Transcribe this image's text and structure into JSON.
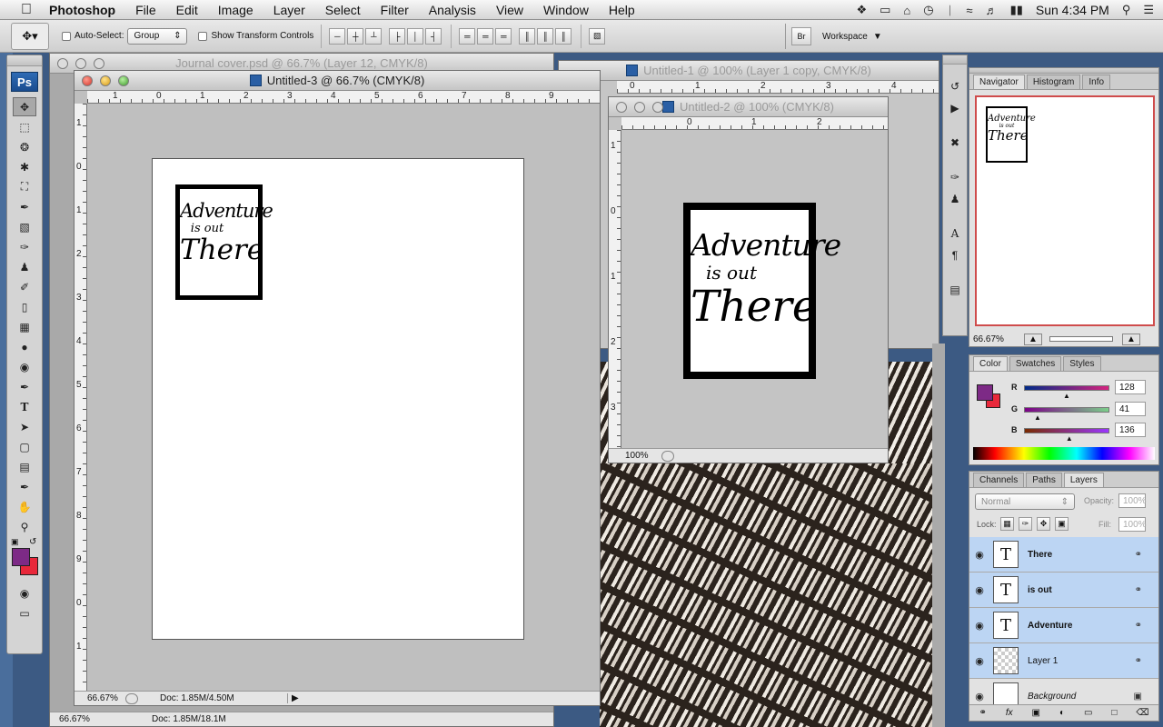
{
  "menubar": {
    "app": "Photoshop",
    "items": [
      "File",
      "Edit",
      "Image",
      "Layer",
      "Select",
      "Filter",
      "Analysis",
      "View",
      "Window",
      "Help"
    ],
    "clock": "Sun 4:34 PM"
  },
  "options": {
    "auto_select_label": "Auto-Select:",
    "auto_select_value": "Group",
    "show_transform_label": "Show Transform Controls",
    "workspace_label": "Workspace"
  },
  "toolbox": {
    "badge": "Ps",
    "foreground_color": "#7d2a86",
    "background_color": "#e8283a"
  },
  "windows": {
    "journal": {
      "title": "Journal cover.psd @ 66.7% (Layer 12, CMYK/8)",
      "zoom": "66.67%",
      "doc": "Doc: 1.85M/18.1M"
    },
    "untitled1": {
      "title": "Untitled-1 @ 100% (Layer 1 copy, CMYK/8)"
    },
    "untitled2": {
      "title": "Untitled-2 @ 100% (CMYK/8)",
      "zoom": "100%"
    },
    "untitled3": {
      "title": "Untitled-3 @ 66.7% (CMYK/8)",
      "zoom": "66.67%",
      "doc": "Doc: 1.85M/4.50M"
    }
  },
  "artwork": {
    "line1": "Adventure",
    "line2": "is out",
    "line3": "There"
  },
  "navigator": {
    "tabs": [
      "Navigator",
      "Histogram",
      "Info"
    ],
    "zoom": "66.67%"
  },
  "color_panel": {
    "tabs": [
      "Color",
      "Swatches",
      "Styles"
    ],
    "r_label": "R",
    "g_label": "G",
    "b_label": "B",
    "r": "128",
    "g": "41",
    "b": "136",
    "r_level": 0.5,
    "g_level": 0.16,
    "b_level": 0.53
  },
  "layers_panel": {
    "tabs": [
      "Channels",
      "Paths",
      "Layers"
    ],
    "blend_mode": "Normal",
    "opacity_label": "Opacity:",
    "opacity_value": "100%",
    "lock_label": "Lock:",
    "fill_label": "Fill:",
    "fill_value": "100%",
    "layers": [
      {
        "name": "There",
        "kind": "T",
        "selected": true
      },
      {
        "name": "is out",
        "kind": "T",
        "selected": true
      },
      {
        "name": "Adventure",
        "kind": "T",
        "selected": true
      },
      {
        "name": "Layer 1",
        "kind": "pixel",
        "selected": true
      },
      {
        "name": "Background",
        "kind": "bg",
        "selected": false
      }
    ]
  }
}
